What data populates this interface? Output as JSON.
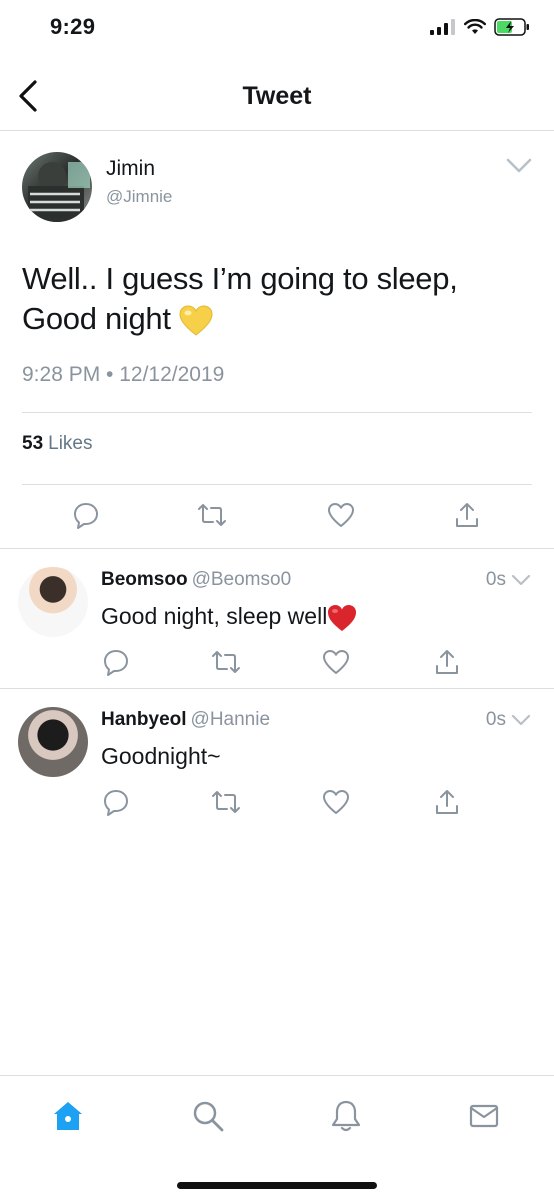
{
  "status_bar": {
    "time": "9:29"
  },
  "header": {
    "title": "Tweet"
  },
  "tweet": {
    "name": "Jimin",
    "handle": "@Jimnie",
    "text_line1": "Well.. I guess I’m going to sleep,",
    "text_line2": "Good night",
    "text_emoji": "yellow-heart",
    "timestamp": "9:28 PM • 12/12/2019",
    "likes_count": "53",
    "likes_label": "Likes"
  },
  "replies": [
    {
      "name": "Beomsoo",
      "handle": "@Beomso0",
      "time": "0s",
      "text": "Good night, sleep well",
      "emoji": "red-heart"
    },
    {
      "name": "Hanbyeol",
      "handle": "@Hannie",
      "time": "0s",
      "text": "Goodnight~"
    }
  ],
  "tabs": [
    "home-icon",
    "search-icon",
    "notifications-icon",
    "messages-icon"
  ],
  "colors": {
    "accent": "#1da1f2",
    "icon_gray": "#8a949e",
    "text": "#14171a",
    "battery": "#4cd964"
  }
}
